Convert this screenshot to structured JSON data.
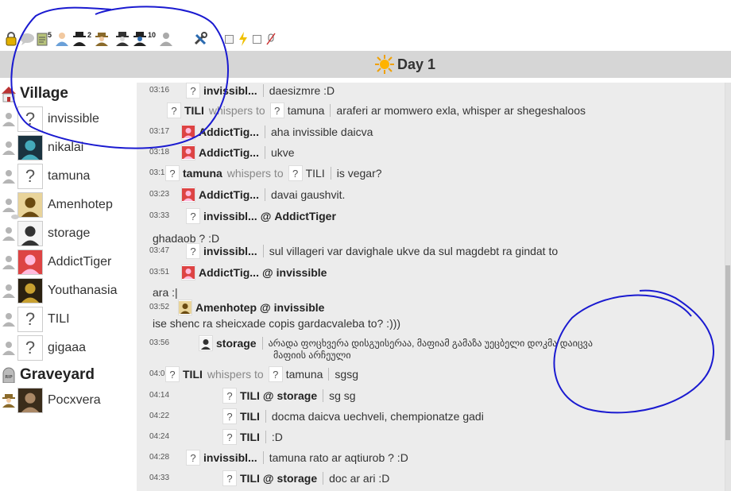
{
  "toolbar": {
    "counts": {
      "notes": "5",
      "gang": "2",
      "shots": "10"
    }
  },
  "day": {
    "title": "Day 1"
  },
  "sidebar": {
    "village_label": "Village",
    "graveyard_label": "Graveyard",
    "players": [
      {
        "name": "invissible"
      },
      {
        "name": "nikalai"
      },
      {
        "name": "tamuna"
      },
      {
        "name": "Amenhotep"
      },
      {
        "name": "storage"
      },
      {
        "name": "AddictTiger"
      },
      {
        "name": "Youthanasia"
      },
      {
        "name": "TILI"
      },
      {
        "name": "gigaaa"
      }
    ],
    "dead": [
      {
        "name": "Pocxvera"
      }
    ]
  },
  "chat": {
    "whispers_label": "whispers to",
    "at": "@",
    "messages": [
      {
        "time": "03:16",
        "author": "invissibl...",
        "text": "daesizmre :D"
      },
      {
        "time": "",
        "author": "TILI",
        "to": "tamuna",
        "text": "araferi ar momwero exla, whisper ar shegeshaloos"
      },
      {
        "time": "03:17",
        "author": "AddictTig...",
        "text": "aha invissible daicva"
      },
      {
        "time": "03:18",
        "author": "AddictTig...",
        "text": "ukve"
      },
      {
        "time": "03:1",
        "author": "tamuna",
        "to": "TILI",
        "text": "is vegar?"
      },
      {
        "time": "03:23",
        "author": "AddictTig...",
        "text": "davai gaushvit."
      },
      {
        "time": "03:33",
        "author": "invissibl...",
        "target": "AddictTiger",
        "text": "ghadaob ? :D"
      },
      {
        "time": "03:47",
        "author": "invissibl...",
        "text": "sul villageri var davighale ukve da sul magdebt ra gindat to"
      },
      {
        "time": "03:51",
        "author": "AddictTig...",
        "target": "invissible",
        "text": "ara :|"
      },
      {
        "time": "03:52",
        "author": "Amenhotep",
        "target": "invissible",
        "text": "ise shenc ra sheicxade copis gardacvaleba to? :)))"
      },
      {
        "time": "03:56",
        "author": "storage",
        "text": "არადა ფოცხვერა დისგუისერაა, მაფიამ გამაზა უეცბელი დოკმა დაიცვა",
        "text2": "მაფიის არჩეული"
      },
      {
        "time": "04:0",
        "author": "TILI",
        "to": "tamuna",
        "text": "sgsg"
      },
      {
        "time": "04:14",
        "author": "TILI",
        "target": "storage",
        "text": "sg sg"
      },
      {
        "time": "04:22",
        "author": "TILI",
        "text": "docma daicva uechveli, chempionatze gadi"
      },
      {
        "time": "04:24",
        "author": "TILI",
        "text": ":D"
      },
      {
        "time": "04:28",
        "author": "invissibl...",
        "text": "tamuna rato ar aqtiurob ? :D"
      },
      {
        "time": "04:33",
        "author": "TILI",
        "target": "storage",
        "text": "doc ar ari :D"
      }
    ]
  }
}
